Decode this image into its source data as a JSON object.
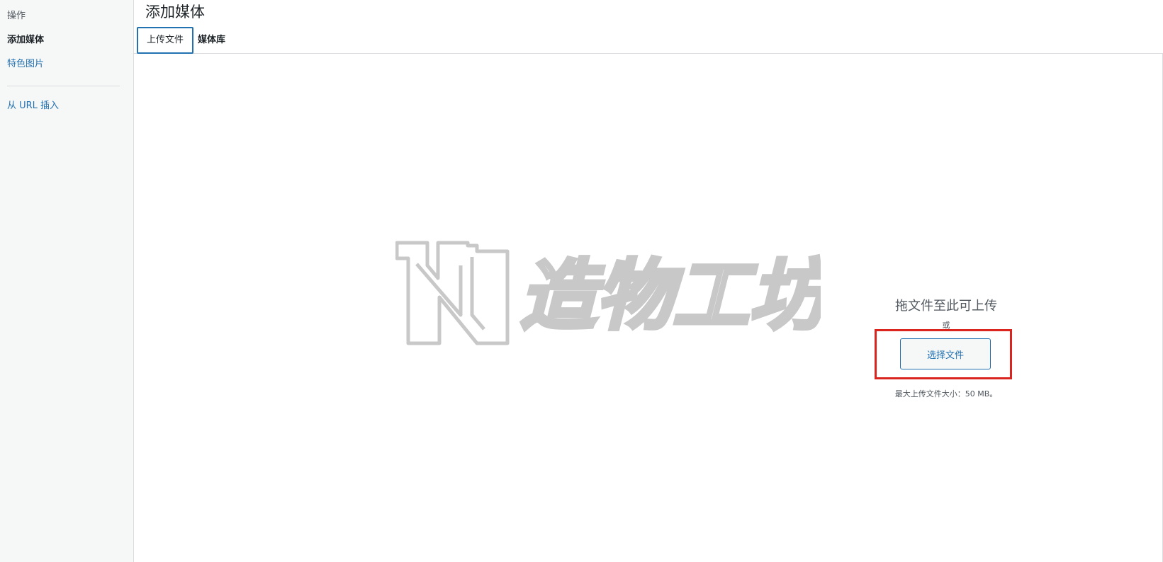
{
  "sidebar": {
    "heading": "操作",
    "items": [
      {
        "label": "添加媒体"
      },
      {
        "label": "特色图片"
      },
      {
        "label": "从 URL 插入"
      }
    ]
  },
  "frame": {
    "title": "添加媒体",
    "tabs": [
      {
        "label": "上传文件"
      },
      {
        "label": "媒体库"
      }
    ]
  },
  "uploader": {
    "drop_instructions": "拖文件至此可上传",
    "or_text": "或",
    "select_button": "选择文件",
    "max_size": "最大上传文件大小：50 MB。"
  },
  "watermark": {
    "text": "造物工坊"
  },
  "colors": {
    "accent": "#2271b1",
    "highlight": "#d9251d",
    "sidebar_bg": "#f6f7f7"
  }
}
